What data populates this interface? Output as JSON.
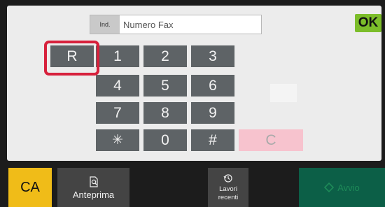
{
  "address": {
    "type_label": "Ind.",
    "placeholder": "Numero Fax"
  },
  "ok_label": "OK",
  "keypad": {
    "r": "R",
    "k1": "1",
    "k2": "2",
    "k3": "3",
    "k4": "4",
    "k5": "5",
    "k6": "6",
    "k7": "7",
    "k8": "8",
    "k9": "9",
    "star": "✳",
    "k0": "0",
    "hash": "#",
    "clear": "C"
  },
  "bottom": {
    "ca": "CA",
    "preview": "Anteprima",
    "recent_line1": "Lavori",
    "recent_line2": "recenti",
    "start": "Avvio"
  },
  "colors": {
    "ok": "#7cbd2a",
    "ca": "#f0bc18",
    "highlight": "#d7213c",
    "start": "#0c5f47",
    "key": "#5e6366",
    "clear": "#f7c3ce"
  },
  "icons": {
    "preview": "magnifier-document-icon",
    "recent": "history-clock-icon",
    "start": "diamond-start-icon"
  }
}
